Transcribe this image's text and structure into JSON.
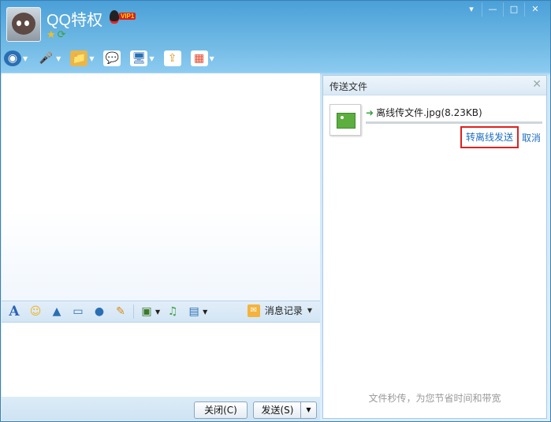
{
  "window": {
    "title": "QQ特权",
    "vip_tag": "VIP1",
    "controls": [
      "▾",
      "—",
      "□",
      "✕"
    ]
  },
  "toolbar": {
    "items": [
      {
        "icon": "video-call-icon",
        "glyph": "◉"
      },
      {
        "icon": "voice-call-icon",
        "glyph": "🎤"
      },
      {
        "icon": "send-file-icon",
        "glyph": "📁"
      },
      {
        "icon": "group-chat-icon",
        "glyph": "💬"
      },
      {
        "icon": "remote-assist-icon",
        "glyph": "🖥"
      },
      {
        "icon": "share-screen-icon",
        "glyph": "⇪"
      },
      {
        "icon": "apps-icon",
        "glyph": "▦"
      }
    ]
  },
  "input_toolbar": {
    "history_label": "消息记录"
  },
  "buttons": {
    "close": "关闭(C)",
    "send": "发送(S)",
    "send_more": "▼"
  },
  "transfer": {
    "header": "传送文件",
    "file_name": "离线传文件.jpg(8.23KB)",
    "offline_send": "转离线发送",
    "cancel": "取消",
    "slogan": "文件秒传，为您节省时间和带宽"
  }
}
